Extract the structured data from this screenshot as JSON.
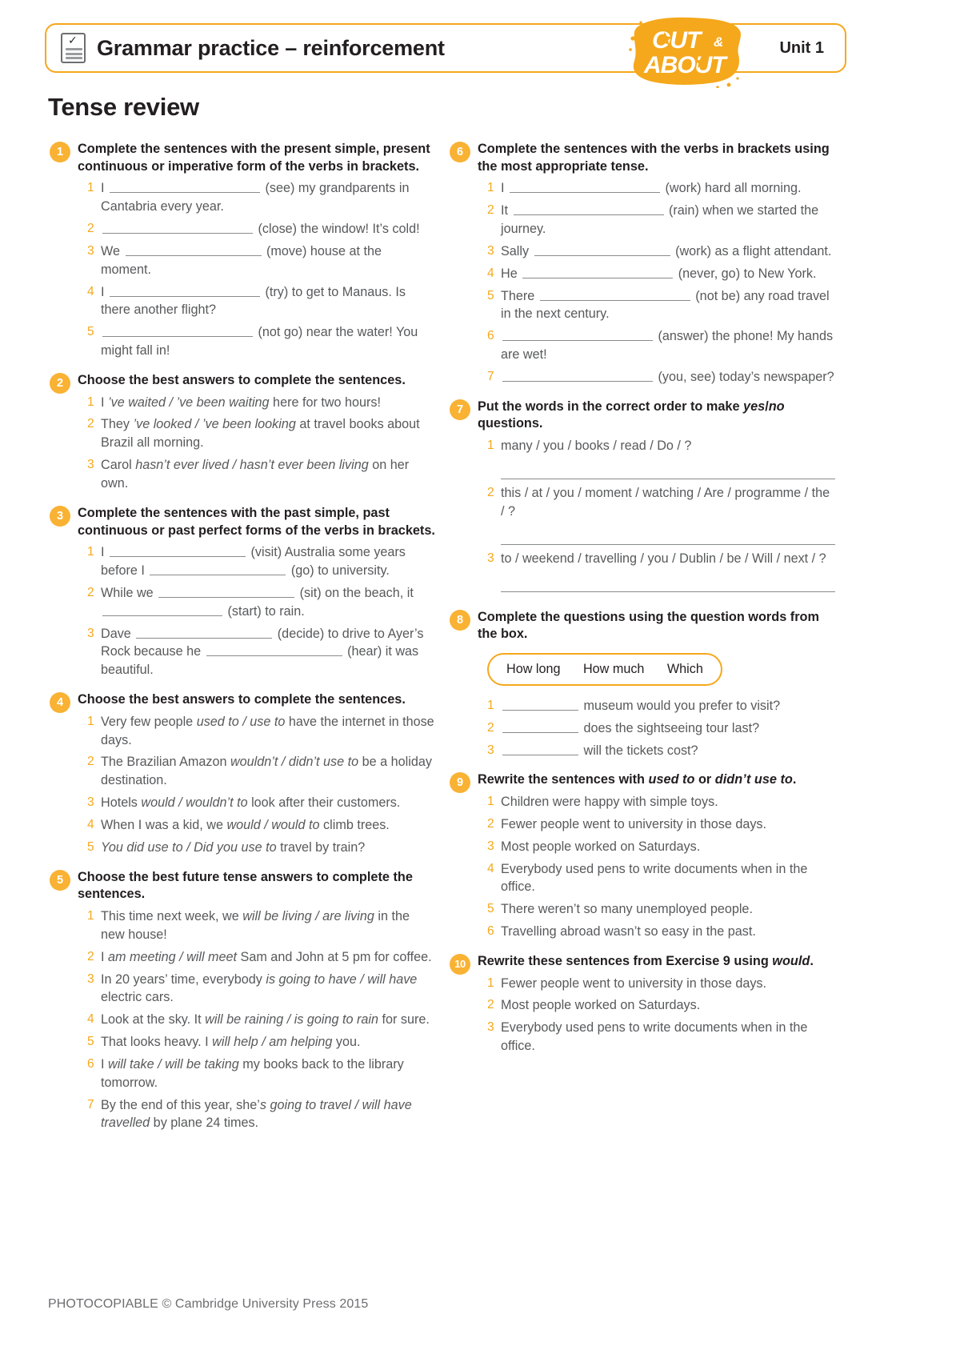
{
  "header": {
    "icon": "checklist-icon",
    "title": "Grammar practice – reinforcement",
    "unit": "Unit 1",
    "logo_line1": "OUT&",
    "logo_line2": "ABOUT",
    "accent_color": "#F5A81C",
    "badge_color": "#F9B233"
  },
  "page_title": "Tense review",
  "footer": "PHOTOCOPIABLE © Cambridge University Press 2015",
  "exercises": [
    {
      "number": "1",
      "instruction": "Complete the sentences with the present simple, present continuous or imperative form of the verbs in brackets.",
      "items": [
        "I ______ (see) my grandparents in Cantabria every year.",
        "______ (close) the window! It’s cold!",
        "We ______ (move) house at the moment.",
        "I ______ (try) to get to Manaus. Is there another flight?",
        "______ (not go) near the water! You might fall in!"
      ]
    },
    {
      "number": "2",
      "instruction": "Choose the best answers to complete the sentences.",
      "items": [
        "I ’ve waited / ’ve been waiting here for two hours!",
        "They ’ve looked / ’ve been looking at travel books about Brazil all morning.",
        "Carol hasn’t ever lived / hasn’t ever been living on her own."
      ]
    },
    {
      "number": "3",
      "instruction": "Complete the sentences with the past simple, past continuous or past perfect forms of the verbs in brackets.",
      "items": [
        "I ______ (visit) Australia some years before I ______ (go) to university.",
        "While we ______ (sit) on the beach, it ______ (start) to rain.",
        "Dave ______ (decide) to drive to Ayer’s Rock because he ______ (hear) it was beautiful."
      ]
    },
    {
      "number": "4",
      "instruction": "Choose the best answers to complete the sentences.",
      "items": [
        "Very few people used to / use to have the internet in those days.",
        "The Brazilian Amazon wouldn’t / didn’t use to be a holiday destination.",
        "Hotels would / wouldn’t to look after their customers.",
        "When I was a kid, we would / would to climb trees.",
        "You did use to / Did you use to travel by train?"
      ]
    },
    {
      "number": "5",
      "instruction": "Choose the best future tense answers to complete the sentences.",
      "items": [
        "This time next week, we will be living / are living in the new house!",
        "I am meeting / will meet Sam and John at 5 pm for coffee.",
        "In 20 years’ time, everybody is going to have / will have electric cars.",
        "Look at the sky. It will be raining / is going to rain for sure.",
        "That looks heavy. I will help / am helping you.",
        "I will take / will be taking my books back to the library tomorrow.",
        "By the end of this year, she’s going to travel / will have travelled by plane 24 times."
      ]
    },
    {
      "number": "6",
      "instruction": "Complete the sentences with the verbs in brackets using the most appropriate tense.",
      "items": [
        "I ______ (work) hard all morning.",
        "It ______ (rain) when we started the journey.",
        "Sally ______ (work) as a flight attendant.",
        "He ______ (never, go) to New York.",
        "There ______ (not be) any road travel in the next century.",
        "______ (answer) the phone! My hands are wet!",
        "______ (you, see) today’s newspaper?"
      ]
    },
    {
      "number": "7",
      "instruction": "Put the words in the correct order to make yes/no questions.",
      "items": [
        "many / you / books / read / Do / ?",
        "this / at / you / moment / watching / Are / programme / the / ?",
        "to / weekend / travelling / you / Dublin / be / Will / next / ?"
      ]
    },
    {
      "number": "8",
      "instruction": "Complete the questions using the question words from the box.",
      "word_box": [
        "How long",
        "How much",
        "Which"
      ],
      "items": [
        "______ museum would you prefer to visit?",
        "______ does the sightseeing tour last?",
        "______ will the tickets cost?"
      ]
    },
    {
      "number": "9",
      "instruction": "Rewrite the sentences with used to or didn’t use to.",
      "items": [
        "Children were happy with simple toys.",
        "Fewer people went to university in those days.",
        "Most people worked on Saturdays.",
        "Everybody used pens to write documents when in the office.",
        "There weren’t so many unemployed people.",
        "Travelling abroad wasn’t so easy in the past."
      ]
    },
    {
      "number": "10",
      "instruction": "Rewrite these sentences from Exercise 9 using would.",
      "items": [
        "Fewer people went to university in those days.",
        "Most people worked on Saturdays.",
        "Everybody used pens to write documents when in the office."
      ]
    }
  ]
}
